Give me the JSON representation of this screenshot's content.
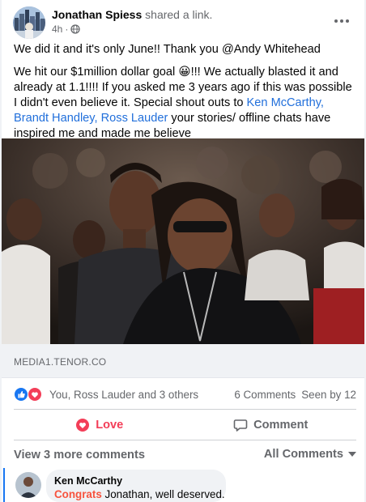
{
  "post": {
    "author": "Jonathan Spiess",
    "action": "shared a link.",
    "timestamp": "4h",
    "separator": "·",
    "paragraph1": "We did it and it's only June!! Thank you @Andy Whitehead",
    "paragraph2": {
      "before": "We hit our $1million dollar goal ",
      "emoji": "😀",
      "middle": "!!! We actually blasted it and already at 1.1!!!! If you asked me 3 years ago if this was possible I didn't even believe it. Special shout outs to ",
      "mentions": "Ken McCarthy, Brandt Handley, Ross Lauder",
      "after": " your stories/ offline chats  have inspired me and made me believe"
    }
  },
  "link": {
    "domain": "MEDIA1.TENOR.CO"
  },
  "reactions": {
    "summary": "You, Ross Lauder and 3 others",
    "comments_count": "6 Comments",
    "seen_by": "Seen by 12"
  },
  "actions": {
    "love_label": "Love",
    "comment_label": "Comment"
  },
  "comments": {
    "view_more": "View 3 more comments",
    "filter_label": "All Comments",
    "first": {
      "author": "Ken McCarthy",
      "highlight": "Congrats",
      "text": " Jonathan, well deserved."
    }
  },
  "colors": {
    "love": "#f33e58",
    "mention": "#216fdb",
    "like_blue": "#1877f2",
    "highlight": "#f7533e"
  },
  "icons": [
    "globe-icon",
    "more-dots-icon",
    "like-reaction-icon",
    "love-reaction-icon",
    "heart-icon",
    "comment-icon",
    "caret-down-icon"
  ]
}
